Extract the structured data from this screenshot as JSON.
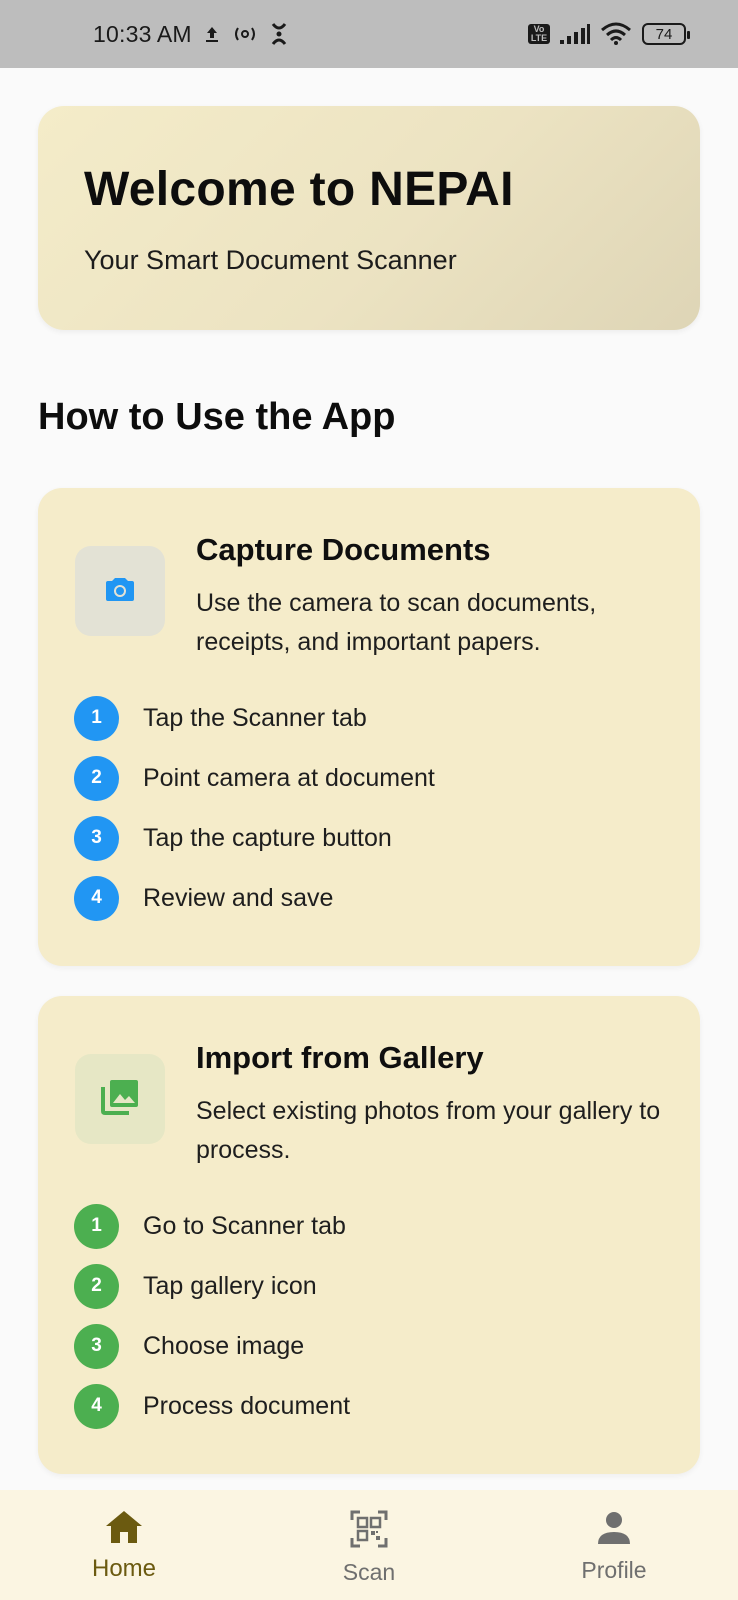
{
  "status_bar": {
    "time": "10:33 AM",
    "battery": "74",
    "volte_top": "Vo",
    "volte_bottom": "LTE",
    "icons": [
      "upload-icon",
      "hotspot-icon",
      "tool-icon",
      "signal-icon",
      "wifi-icon",
      "battery-icon"
    ]
  },
  "welcome": {
    "title": "Welcome to NEPAI",
    "subtitle": "Your Smart Document Scanner"
  },
  "section_title": "How to Use the App",
  "cards": [
    {
      "title": "Capture Documents",
      "description": "Use the camera to scan documents, receipts, and important papers.",
      "icon": "camera-icon",
      "accent": "#2196f3",
      "steps": [
        {
          "num": "1",
          "text": "Tap the Scanner tab"
        },
        {
          "num": "2",
          "text": "Point camera at document"
        },
        {
          "num": "3",
          "text": "Tap the capture button"
        },
        {
          "num": "4",
          "text": "Review and save"
        }
      ]
    },
    {
      "title": "Import from Gallery",
      "description": "Select existing photos from your gallery to process.",
      "icon": "gallery-icon",
      "accent": "#4caf50",
      "steps": [
        {
          "num": "1",
          "text": "Go to Scanner tab"
        },
        {
          "num": "2",
          "text": "Tap gallery icon"
        },
        {
          "num": "3",
          "text": "Choose image"
        },
        {
          "num": "4",
          "text": "Process document"
        }
      ]
    }
  ],
  "nav": {
    "items": [
      {
        "label": "Home",
        "icon": "home-icon",
        "active": true
      },
      {
        "label": "Scan",
        "icon": "qr-scan-icon",
        "active": false
      },
      {
        "label": "Profile",
        "icon": "person-icon",
        "active": false
      }
    ],
    "active_color": "#6b5a10",
    "inactive_color": "#6f6f6f"
  }
}
